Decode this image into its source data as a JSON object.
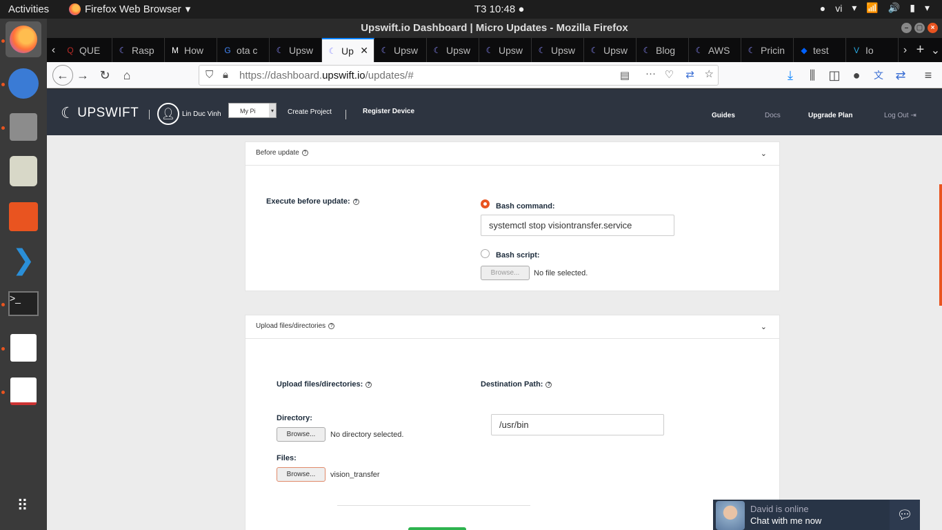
{
  "topbar": {
    "activities": "Activities",
    "app": "Firefox Web Browser",
    "clock": "T3 10:48",
    "lang": "vi"
  },
  "window": {
    "title": "Upswift.io Dashboard | Micro Updates - Mozilla Firefox"
  },
  "tabs": [
    {
      "label": "QUE",
      "icon": "quora-icon"
    },
    {
      "label": "Rasp",
      "icon": "upswift-icon"
    },
    {
      "label": "How",
      "icon": "medium-icon"
    },
    {
      "label": "ota c",
      "icon": "google-icon"
    },
    {
      "label": "Upsw",
      "icon": "upswift-icon"
    },
    {
      "label": "Up",
      "icon": "upswift-icon",
      "active": true
    },
    {
      "label": "Upsw",
      "icon": "upswift-icon"
    },
    {
      "label": "Upsw",
      "icon": "upswift-icon"
    },
    {
      "label": "Upsw",
      "icon": "upswift-icon"
    },
    {
      "label": "Upsw",
      "icon": "upswift-icon"
    },
    {
      "label": "Upsw",
      "icon": "upswift-icon"
    },
    {
      "label": "Blog",
      "icon": "upswift-icon"
    },
    {
      "label": "AWS",
      "icon": "upswift-icon"
    },
    {
      "label": "Pricin",
      "icon": "upswift-icon"
    },
    {
      "label": "test",
      "icon": "dropbox-icon"
    },
    {
      "label": "Io",
      "icon": "vercel-icon"
    }
  ],
  "url": {
    "prefix": "https://dashboard.",
    "host": "upswift.io",
    "path": "/updates/#"
  },
  "app": {
    "logo": "UPSWIFT",
    "user": "Lin Duc Vinh",
    "project_select": "My Pi",
    "create_project": "Create Project",
    "register_device": "Register Device",
    "guides": "Guides",
    "docs": "Docs",
    "upgrade": "Upgrade Plan",
    "logout": "Log Out"
  },
  "before_update": {
    "header": "Before update",
    "execute_label": "Execute before update:",
    "bash_command_label": "Bash command:",
    "bash_command_value": "systemctl stop visiontransfer.service",
    "bash_script_label": "Bash script:",
    "browse": "Browse...",
    "no_file": "No file selected."
  },
  "upload": {
    "header": "Upload files/directories",
    "upload_label": "Upload files/directories:",
    "dest_label": "Destination Path:",
    "directory_label": "Directory:",
    "dir_browse": "Browse...",
    "no_dir": "No directory selected.",
    "dest_value": "/usr/bin",
    "files_label": "Files:",
    "files_browse": "Browse...",
    "file_name": "vision_transfer"
  },
  "chat": {
    "status": "David is online",
    "cta": "Chat with me now"
  },
  "colors": {
    "accent": "#e95420",
    "header": "#2d3440",
    "green": "#2eb34f"
  }
}
